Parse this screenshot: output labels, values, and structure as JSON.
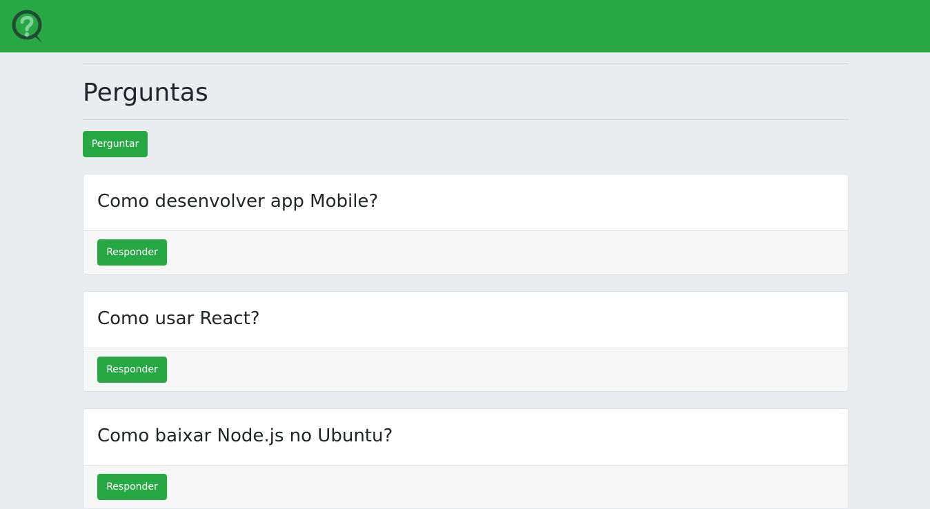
{
  "header": {
    "logo_icon": "question-chat-bubble-icon",
    "brand_color": "#28a745"
  },
  "page": {
    "title": "Perguntas",
    "ask_button_label": "Perguntar"
  },
  "questions": [
    {
      "title": "Como desenvolver app Mobile?",
      "reply_label": "Responder"
    },
    {
      "title": "Como usar React?",
      "reply_label": "Responder"
    },
    {
      "title": "Como baixar Node.js no Ubuntu?",
      "reply_label": "Responder"
    }
  ],
  "colors": {
    "accent": "#28a745",
    "background": "#eaedf0",
    "card": "#ffffff",
    "card_footer": "#f6f6f6",
    "text": "#212529"
  }
}
